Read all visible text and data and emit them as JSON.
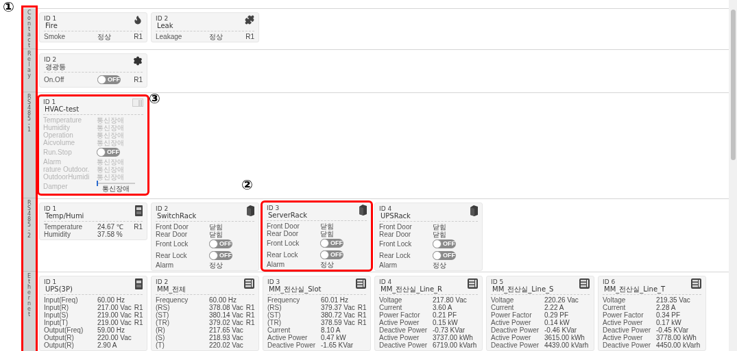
{
  "sections": [
    {
      "label": "Contact",
      "cards": [
        {
          "id": "ID 1",
          "name": "Fire",
          "kind": "fire",
          "disabled": false,
          "highlight": false,
          "rows": [
            {
              "kind": "text",
              "label": "Smoke",
              "value": "정상",
              "unit": "R1"
            }
          ]
        },
        {
          "id": "ID 2",
          "name": "Leak",
          "kind": "leak",
          "disabled": false,
          "highlight": false,
          "rows": [
            {
              "kind": "text",
              "label": "Leakage",
              "value": "정상",
              "unit": "R1"
            }
          ]
        }
      ]
    },
    {
      "label": "Relay",
      "cards": [
        {
          "id": "ID 2",
          "name": "경광등",
          "kind": "gear",
          "disabled": false,
          "highlight": false,
          "rows": [
            {
              "kind": "toggle",
              "label": "On.Off",
              "on": false,
              "value": "OFF",
              "unit": "R1"
            }
          ]
        }
      ]
    },
    {
      "label": "RS485 - 1",
      "cards": [
        {
          "id": "ID 1",
          "name": "HVAC-test",
          "kind": "hvac",
          "disabled": true,
          "highlight": true,
          "rows": [
            {
              "kind": "text",
              "label": "Temperature",
              "value": "통신장애"
            },
            {
              "kind": "text",
              "label": "Humidity",
              "value": "통신장애"
            },
            {
              "kind": "text",
              "label": "Operation",
              "value": "통신장애"
            },
            {
              "kind": "text",
              "label": "Aicvolume",
              "value": "통신장애"
            },
            {
              "kind": "toggle",
              "label": "Run.Stop",
              "on": false,
              "value": "OFF"
            },
            {
              "kind": "text",
              "label": "Alarm",
              "value": "통신장애"
            },
            {
              "kind": "text",
              "label": "rature Outdoor.",
              "value": "통신장애"
            },
            {
              "kind": "text",
              "label": "OutdoorHumidi",
              "value": "통신장애"
            },
            {
              "kind": "slider",
              "label": "Damper",
              "level": 0.0,
              "value": "통신장애"
            }
          ]
        }
      ]
    },
    {
      "label": "RS485 - 2",
      "cards": [
        {
          "id": "ID 1",
          "name": "Temp/Humi",
          "kind": "sensor",
          "disabled": false,
          "highlight": false,
          "rows": [
            {
              "kind": "text",
              "label": "Temperature",
              "value": "24.67 ℃",
              "unit": "R1"
            },
            {
              "kind": "text",
              "label": "Humidity",
              "value": "37.58 %"
            }
          ]
        },
        {
          "id": "ID 2",
          "name": "SwitchRack",
          "kind": "rack",
          "disabled": false,
          "highlight": false,
          "rows": [
            {
              "kind": "text",
              "label": "Front Door",
              "value": "닫힘"
            },
            {
              "kind": "text",
              "label": "Rear Door",
              "value": "닫힘"
            },
            {
              "kind": "toggle",
              "label": "Front Lock",
              "on": false,
              "value": "OFF"
            },
            {
              "kind": "toggle",
              "label": "Rear Lock",
              "on": false,
              "value": "OFF"
            },
            {
              "kind": "text",
              "label": "Alarm",
              "value": "정상"
            }
          ]
        },
        {
          "id": "ID 3",
          "name": "ServerRack",
          "kind": "rack",
          "disabled": false,
          "highlight": true,
          "rows": [
            {
              "kind": "text",
              "label": "Front Door",
              "value": "닫힘"
            },
            {
              "kind": "text",
              "label": "Rear Door",
              "value": "닫힘"
            },
            {
              "kind": "toggle",
              "label": "Front Lock",
              "on": false,
              "value": "OFF"
            },
            {
              "kind": "toggle",
              "label": "Rear Lock",
              "on": false,
              "value": "OFF"
            },
            {
              "kind": "text",
              "label": "Alarm",
              "value": "정상"
            }
          ]
        },
        {
          "id": "ID 4",
          "name": "UPSRack",
          "kind": "rack",
          "disabled": false,
          "highlight": false,
          "rows": [
            {
              "kind": "text",
              "label": "Front Door",
              "value": "닫힘"
            },
            {
              "kind": "text",
              "label": "Rear Door",
              "value": "닫힘"
            },
            {
              "kind": "toggle",
              "label": "Front Lock",
              "on": false,
              "value": "OFF"
            },
            {
              "kind": "toggle",
              "label": "Rear Lock",
              "on": false,
              "value": "OFF"
            },
            {
              "kind": "text",
              "label": "Alarm",
              "value": "정상"
            }
          ]
        }
      ]
    },
    {
      "label": "Ethernet",
      "cards": [
        {
          "id": "ID 1",
          "name": "UPS(3P)",
          "kind": "sensor",
          "disabled": false,
          "highlight": false,
          "rows": [
            {
              "kind": "text",
              "label": "Input(Freq)",
              "value": "60.00 Hz"
            },
            {
              "kind": "text",
              "label": "Input(R)",
              "value": "217.00 Vac",
              "unit": "R1"
            },
            {
              "kind": "text",
              "label": "Input(S)",
              "value": "219.00 Vac",
              "unit": "R1"
            },
            {
              "kind": "text",
              "label": "Input(T)",
              "value": "219.00 Vac",
              "unit": "R1"
            },
            {
              "kind": "text",
              "label": "Output(Freq)",
              "value": "59.00 Hz"
            },
            {
              "kind": "text",
              "label": "Output(R)",
              "value": "220.00 Vac"
            },
            {
              "kind": "text",
              "label": "Output(R)",
              "value": "2.90 A"
            }
          ]
        },
        {
          "id": "ID 2",
          "name": "MM_전체",
          "kind": "meter",
          "disabled": false,
          "highlight": false,
          "rows": [
            {
              "kind": "text",
              "label": "Frequency",
              "value": "60.00 Hz"
            },
            {
              "kind": "text",
              "label": "(RS)",
              "value": "378.08 Vac",
              "unit": "R1"
            },
            {
              "kind": "text",
              "label": "(ST)",
              "value": "380.14 Vac",
              "unit": "R1"
            },
            {
              "kind": "text",
              "label": "(TR)",
              "value": "379.02 Vac",
              "unit": "R1"
            },
            {
              "kind": "text",
              "label": "(R)",
              "value": "217.65 Vac"
            },
            {
              "kind": "text",
              "label": "(S)",
              "value": "218.93 Vac"
            },
            {
              "kind": "text",
              "label": "(T)",
              "value": "220.02 Vac"
            }
          ]
        },
        {
          "id": "ID 3",
          "name": "MM_전산실_Slot",
          "kind": "meter",
          "disabled": false,
          "highlight": false,
          "rows": [
            {
              "kind": "text",
              "label": "Frequency",
              "value": "60.01 Hz"
            },
            {
              "kind": "text",
              "label": "(RS)",
              "value": "379.37 Vac",
              "unit": "R1"
            },
            {
              "kind": "text",
              "label": "(ST)",
              "value": "380.72 Vac",
              "unit": "R1"
            },
            {
              "kind": "text",
              "label": "(TR)",
              "value": "378.59 Vac",
              "unit": "R1"
            },
            {
              "kind": "text",
              "label": "Current",
              "value": "8.10 A"
            },
            {
              "kind": "text",
              "label": "Active Power",
              "value": "0.47 kW"
            },
            {
              "kind": "text",
              "label": "Deactive Power",
              "value": "-1.65 KVar"
            }
          ]
        },
        {
          "id": "ID 4",
          "name": "MM_전산실_Line_R",
          "kind": "meter",
          "disabled": false,
          "highlight": false,
          "rows": [
            {
              "kind": "text",
              "label": "Voltage",
              "value": "217.80 Vac"
            },
            {
              "kind": "text",
              "label": "Current",
              "value": "3.60 A"
            },
            {
              "kind": "text",
              "label": "Power Factor",
              "value": "0.21 PF"
            },
            {
              "kind": "text",
              "label": "Active Power",
              "value": "0.15 kW"
            },
            {
              "kind": "text",
              "label": "Deactive Power",
              "value": "-0.73 KVar"
            },
            {
              "kind": "text",
              "label": "Active Power",
              "value": "3737.00 kWh"
            },
            {
              "kind": "text",
              "label": "Deactive Power",
              "value": "6719.00 kVarh"
            }
          ]
        },
        {
          "id": "ID 5",
          "name": "MM_전산실_Line_S",
          "kind": "meter",
          "disabled": false,
          "highlight": false,
          "rows": [
            {
              "kind": "text",
              "label": "Voltage",
              "value": "220.26 Vac"
            },
            {
              "kind": "text",
              "label": "Current",
              "value": "2.22 A"
            },
            {
              "kind": "text",
              "label": "Power Factor",
              "value": "0.29 PF"
            },
            {
              "kind": "text",
              "label": "Active Power",
              "value": "0.14 kW"
            },
            {
              "kind": "text",
              "label": "Deactive Power",
              "value": "-0.46 KVar"
            },
            {
              "kind": "text",
              "label": "Active Power",
              "value": "3615.00 kWh"
            },
            {
              "kind": "text",
              "label": "Deactive Power",
              "value": "4439.00 kVarh"
            }
          ]
        },
        {
          "id": "ID 6",
          "name": "MM_전산실_Line_T",
          "kind": "meter",
          "disabled": false,
          "highlight": false,
          "rows": [
            {
              "kind": "text",
              "label": "Voltage",
              "value": "219.35 Vac"
            },
            {
              "kind": "text",
              "label": "Current",
              "value": "2.28 A"
            },
            {
              "kind": "text",
              "label": "Power Factor",
              "value": "0.34 PF"
            },
            {
              "kind": "text",
              "label": "Active Power",
              "value": "0.17 kW"
            },
            {
              "kind": "text",
              "label": "Deactive Power",
              "value": "-0.45 KVar"
            },
            {
              "kind": "text",
              "label": "Active Power",
              "value": "3778.00 kWh"
            },
            {
              "kind": "text",
              "label": "Deactive Power",
              "value": "4450.00 kVarh"
            }
          ]
        }
      ]
    }
  ],
  "sidebar_highlight": true,
  "annotations": [
    "①",
    "②",
    "③"
  ]
}
